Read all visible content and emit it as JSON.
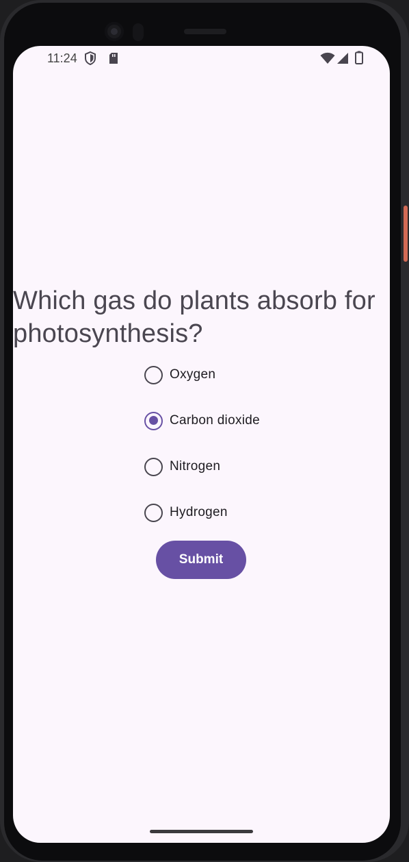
{
  "status_bar": {
    "time": "11:24",
    "left_icons": [
      "shield-icon",
      "sd-card-icon"
    ],
    "right_icons": [
      "wifi-icon",
      "cellular-signal-icon",
      "battery-icon"
    ]
  },
  "quiz": {
    "question": "Which gas do plants absorb for photosynthesis?",
    "options": [
      {
        "label": "Oxygen",
        "selected": false
      },
      {
        "label": "Carbon dioxide",
        "selected": true
      },
      {
        "label": "Nitrogen",
        "selected": false
      },
      {
        "label": "Hydrogen",
        "selected": false
      }
    ],
    "submit_label": "Submit"
  },
  "colors": {
    "accent": "#6750a4",
    "background": "#fcf6fd",
    "text": "#1d1b20",
    "question_text": "#4a4650",
    "device_frame": "#2a2a2d",
    "side_button": "#d26a55"
  }
}
